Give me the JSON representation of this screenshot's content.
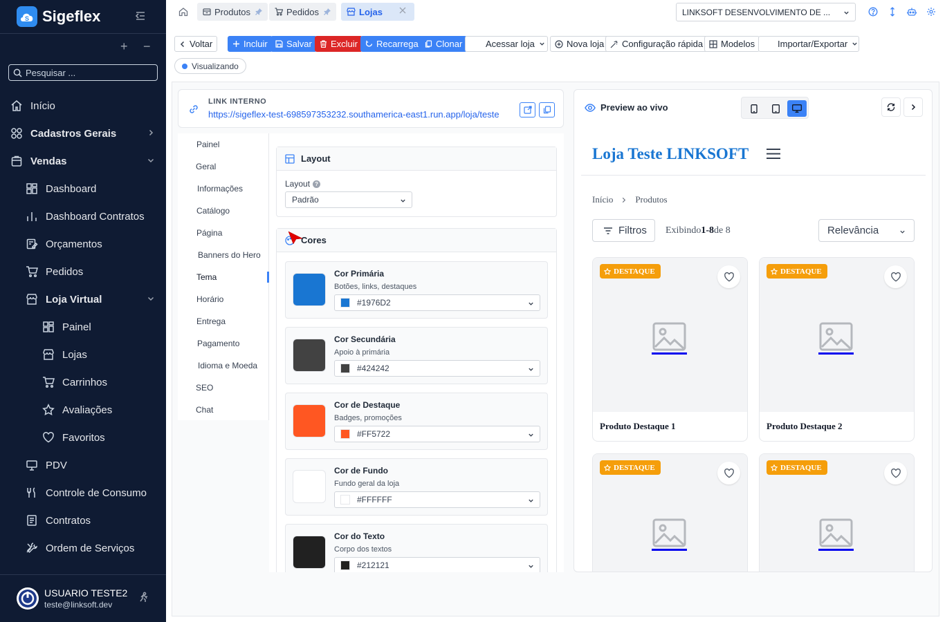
{
  "app": {
    "brand": "Sigeflex",
    "search_placeholder": "Pesquisar ..."
  },
  "colors": {
    "sidebar_bg": "#0f1b33",
    "accent": "#3b82f6",
    "danger": "#dc2626",
    "store_primary": "#1976D2",
    "badge": "#f59e0b"
  },
  "sidebar": {
    "items": [
      {
        "label": "Início",
        "icon": "home-icon",
        "level": 0,
        "bold": false
      },
      {
        "label": "Cadastros Gerais",
        "icon": "grid-icon",
        "level": 0,
        "bold": true,
        "chevron": "right"
      },
      {
        "label": "Vendas",
        "icon": "bag-icon",
        "level": 0,
        "bold": true,
        "chevron": "down"
      },
      {
        "label": "Dashboard",
        "icon": "dashboard-icon",
        "level": 1
      },
      {
        "label": "Dashboard Contratos",
        "icon": "bar-chart-icon",
        "level": 1
      },
      {
        "label": "Orçamentos",
        "icon": "document-edit-icon",
        "level": 1
      },
      {
        "label": "Pedidos",
        "icon": "cart-icon",
        "level": 1
      },
      {
        "label": "Loja Virtual",
        "icon": "store-icon",
        "level": 1,
        "bold": true,
        "chevron": "down"
      },
      {
        "label": "Painel",
        "icon": "dashboard-icon",
        "level": 2
      },
      {
        "label": "Lojas",
        "icon": "store-icon",
        "level": 2
      },
      {
        "label": "Carrinhos",
        "icon": "cart-icon",
        "level": 2
      },
      {
        "label": "Avaliações",
        "icon": "star-icon",
        "level": 2
      },
      {
        "label": "Favoritos",
        "icon": "heart-icon",
        "level": 2
      },
      {
        "label": "PDV",
        "icon": "monitor-icon",
        "level": 1
      },
      {
        "label": "Controle de Consumo",
        "icon": "utensils-icon",
        "level": 1
      },
      {
        "label": "Contratos",
        "icon": "contract-icon",
        "level": 1
      },
      {
        "label": "Ordem de Serviços",
        "icon": "tools-icon",
        "level": 1
      }
    ]
  },
  "user": {
    "name": "USUARIO TESTE2",
    "email": "teste@linksoft.dev"
  },
  "tabs": [
    {
      "label": "Produtos",
      "icon": "box-icon",
      "pinned": true
    },
    {
      "label": "Pedidos",
      "icon": "cart-icon",
      "pinned": true
    },
    {
      "label": "Lojas",
      "icon": "store-icon",
      "active": true,
      "closable": true
    }
  ],
  "company_select": "LINKSOFT DESENVOLVIMENTO DE ...",
  "toolbar": {
    "voltar": "Voltar",
    "incluir": "Incluir",
    "salvar": "Salvar",
    "excluir": "Excluir",
    "recarrega": "Recarrega",
    "clonar": "Clonar",
    "acessar_loja": "Acessar loja",
    "nova_loja": "Nova loja",
    "config_rapida": "Configuração rápida",
    "modelos": "Modelos",
    "importar": "Importar/Exportar"
  },
  "status": "Visualizando",
  "link": {
    "label": "LINK INTERNO",
    "url": "https://sigeflex-test-698597353232.southamerica-east1.run.app/loja/teste"
  },
  "settings_nav": [
    "Painel",
    "Geral",
    "Informações",
    "Catálogo",
    "Página",
    "Banners do Hero",
    "Tema",
    "Horário",
    "Entrega",
    "Pagamento",
    "Idioma e Moeda",
    "SEO",
    "Chat"
  ],
  "settings_active": "Tema",
  "layout_card": {
    "title": "Layout",
    "field_label": "Layout",
    "help": "?",
    "value": "Padrão"
  },
  "colors_card": {
    "title": "Cores",
    "rows": [
      {
        "title": "Cor Primária",
        "desc": "Botões, links, destaques",
        "hex": "#1976D2"
      },
      {
        "title": "Cor Secundária",
        "desc": "Apoio à primária",
        "hex": "#424242"
      },
      {
        "title": "Cor de Destaque",
        "desc": "Badges, promoções",
        "hex": "#FF5722"
      },
      {
        "title": "Cor de Fundo",
        "desc": "Fundo geral da loja",
        "hex": "#FFFFFF"
      },
      {
        "title": "Cor do Texto",
        "desc": "Corpo dos textos",
        "hex": "#212121"
      }
    ]
  },
  "preview": {
    "title": "Preview ao vivo",
    "active_device": "desktop",
    "store_name": "Loja Teste LINKSOFT",
    "breadcrumb": [
      "Início",
      "Produtos"
    ],
    "filters": "Filtros",
    "showing_prefix": "Exibindo",
    "showing_range": "1-8",
    "showing_suffix": "de 8",
    "sort": "Relevância",
    "badge": "DESTAQUE",
    "products": [
      "Produto Destaque 1",
      "Produto Destaque 2",
      "",
      ""
    ]
  }
}
